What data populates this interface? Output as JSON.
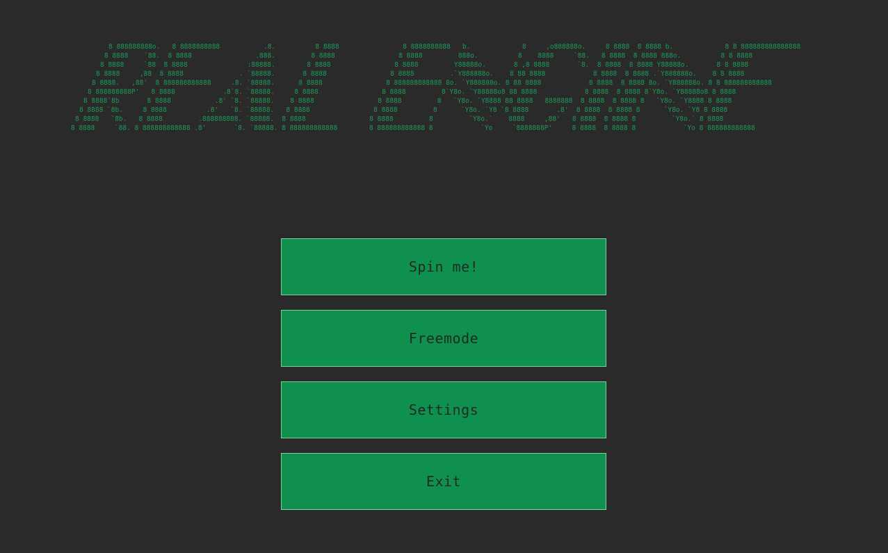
{
  "logo": {
    "lines": [
      "8 888888888o.   8 8888888888           .8.          8 8888                8 8888888888   b.             8     ,o888888o.     8 8888  8 8888 b.             8 8 888888888888888",
      "8 8888    `88.  8 8888                .888.         8 8888                8 8888         888o.          8    8888     `88.   8 8888  8 8888 888o.          8 8 8888",
      "8 8888     `88  8 8888               :88888.        8 8888                8 8888         Y88888o.       8 ,8 8888       `8.  8 8888  8 8888 Y88888o.       8 8 8888",
      "8 8888     ,88  8 8888              . `88888.       8 8888                8 8888         .`Y888888o.    8 88 8888            8 8888  8 8888 .`Y888888o.    8 8 8888",
      "8 8888.   ,88'  8 888888888888     .8. `88888.      8 8888                8 888888888888 8o. `Y888888o. 8 88 8888            8 8888  8 8888 8o. `Y888888o. 8 8 888888888888",
      "8 888888888P'   8 8888            .8`8. `88888.     8 8888                8 8888         8`Y8o. `Y88888o8 88 8888            8 8888  8 8888 8`Y8o. `Y88888o8 8 8888",
      "8 8888`8b       8 8888           .8' `8. `88888.    8 8888                8 8888         8   `Y8o. `Y8888 88 8888   8888888  8 8888  8 8888 8   `Y8o. `Y8888 8 8888",
      "8 8888 `8b.     8 8888          .8'   `8. `88888.   8 8888                8 8888         8      `Y8o. `Y8 `8 8888       .8'  8 8888  8 8888 8      `Y8o. `Y8 8 8888",
      "8 8888   `8b.   8 8888         .888888888. `88888.  8 8888                8 8888         8         `Y8o.`    8888     ,88'   8 8888  8 8888 8         `Y8o.` 8 8888",
      "8 8888     `88. 8 888888888888 .8'       `8. `88888. 8 888888888888        8 888888888888 8            `Yo     `8888888P'     8 8888  8 8888 8            `Yo 8 888888888888"
    ]
  },
  "menu": {
    "spin_label": "Spin me!",
    "freemode_label": "Freemode",
    "settings_label": "Settings",
    "exit_label": "Exit"
  },
  "colors": {
    "background": "#2a2a2a",
    "logo_text": "#1e9a55",
    "button_fill": "#10904f",
    "button_border": "#7fcf9e",
    "button_text": "#1f2a22"
  }
}
